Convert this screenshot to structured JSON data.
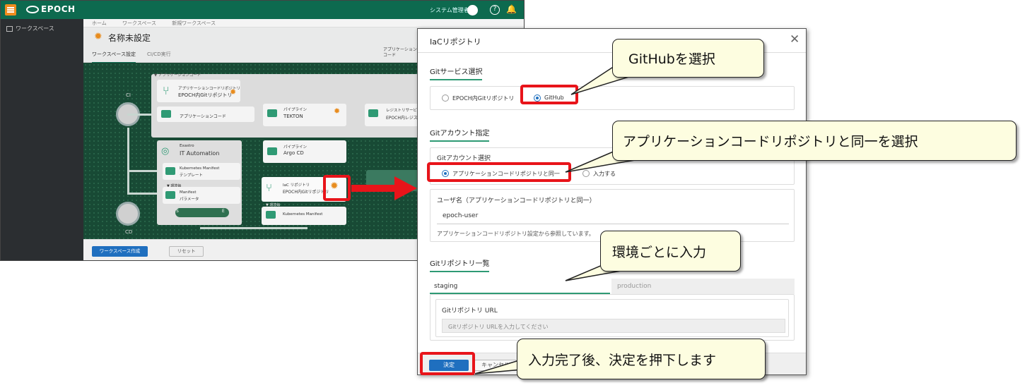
{
  "app": {
    "logo_text": "EPOCH",
    "user_name": "システム管理者",
    "help_glyph": "?",
    "bell_glyph": "🔔",
    "sidebar_item": "ワークスペース",
    "breadcrumbs": [
      "ホーム",
      "ワークスペース",
      "新規ワークスペース"
    ],
    "page_title": "名称未設定",
    "tabs": [
      "ワークスペース設定",
      "CI/CD実行"
    ],
    "app_code_label": "アプリケーションコード",
    "canvas": {
      "ci_label": "CI",
      "cd_label": "CD",
      "app_code_group": "▼ アプリケーションコード",
      "repo_subtitle": "アプリケーションコードリポジトリ",
      "repo_title": "EPOCH内Gitリポジトリ",
      "app_code_node": "アプリケーションコード",
      "pipeline_small": "パイプライン",
      "tekton": "TEKTON",
      "registry_small": "レジストリサービス",
      "registry_title": "EPOCH内レジストリ",
      "exastro_small": "Exastro",
      "it_automation": "IT Automation",
      "argo_small": "パイプライン",
      "argo": "Argo CD",
      "k8s_template_1": "Kubernetes Manifest",
      "k8s_template_2": "テンプレート",
      "env_small": "▼ 環境毎",
      "manifest_1": "Manifest",
      "manifest_2": "パラメータ",
      "iac_small": "IaC リポジトリ",
      "iac_title": "EPOCH内Gitリポジトリ",
      "k8s_manifest": "Kubernetes Manifest",
      "env_small_2": "▼ 環境毎",
      "s_label": "S",
      "e_label": "E"
    },
    "create_button": "ワークスペース作成",
    "reset_button": "リセット"
  },
  "dialog": {
    "title": "IaCリポジトリ",
    "close_glyph": "✕",
    "git_service_title": "Gitサービス選択",
    "git_service_options": [
      "EPOCH内Gitリポジトリ",
      "GitHub"
    ],
    "git_account_title": "Gitアカウント指定",
    "git_account_select_label": "Gitアカウント選択",
    "git_account_options": [
      "アプリケーションコードリポジトリと同一",
      "入力する"
    ],
    "username_label": "ユーザ名（アプリケーションコードリポジトリと同一）",
    "username_value": "epoch-user",
    "username_note": "アプリケーションコードリポジトリ設定から参照しています。",
    "repo_list_title": "Gitリポジトリ一覧",
    "env_tabs": [
      "staging",
      "production"
    ],
    "repo_url_label": "Gitリポジトリ URL",
    "repo_url_placeholder": "Gitリポジトリ URLを入力してください",
    "ok_button": "決定",
    "cancel_button": "キャンセル"
  },
  "callouts": {
    "github": "GitHubを選択",
    "account": "アプリケーションコードリポジトリと同一を選択",
    "env": "環境ごとに入力",
    "done": "入力完了後、決定を押下します"
  },
  "colors": {
    "highlight": "#e8141a",
    "callout_bg": "#fdfde0",
    "brand_green": "#0d6a4f",
    "primary_blue": "#1f6fbf"
  }
}
